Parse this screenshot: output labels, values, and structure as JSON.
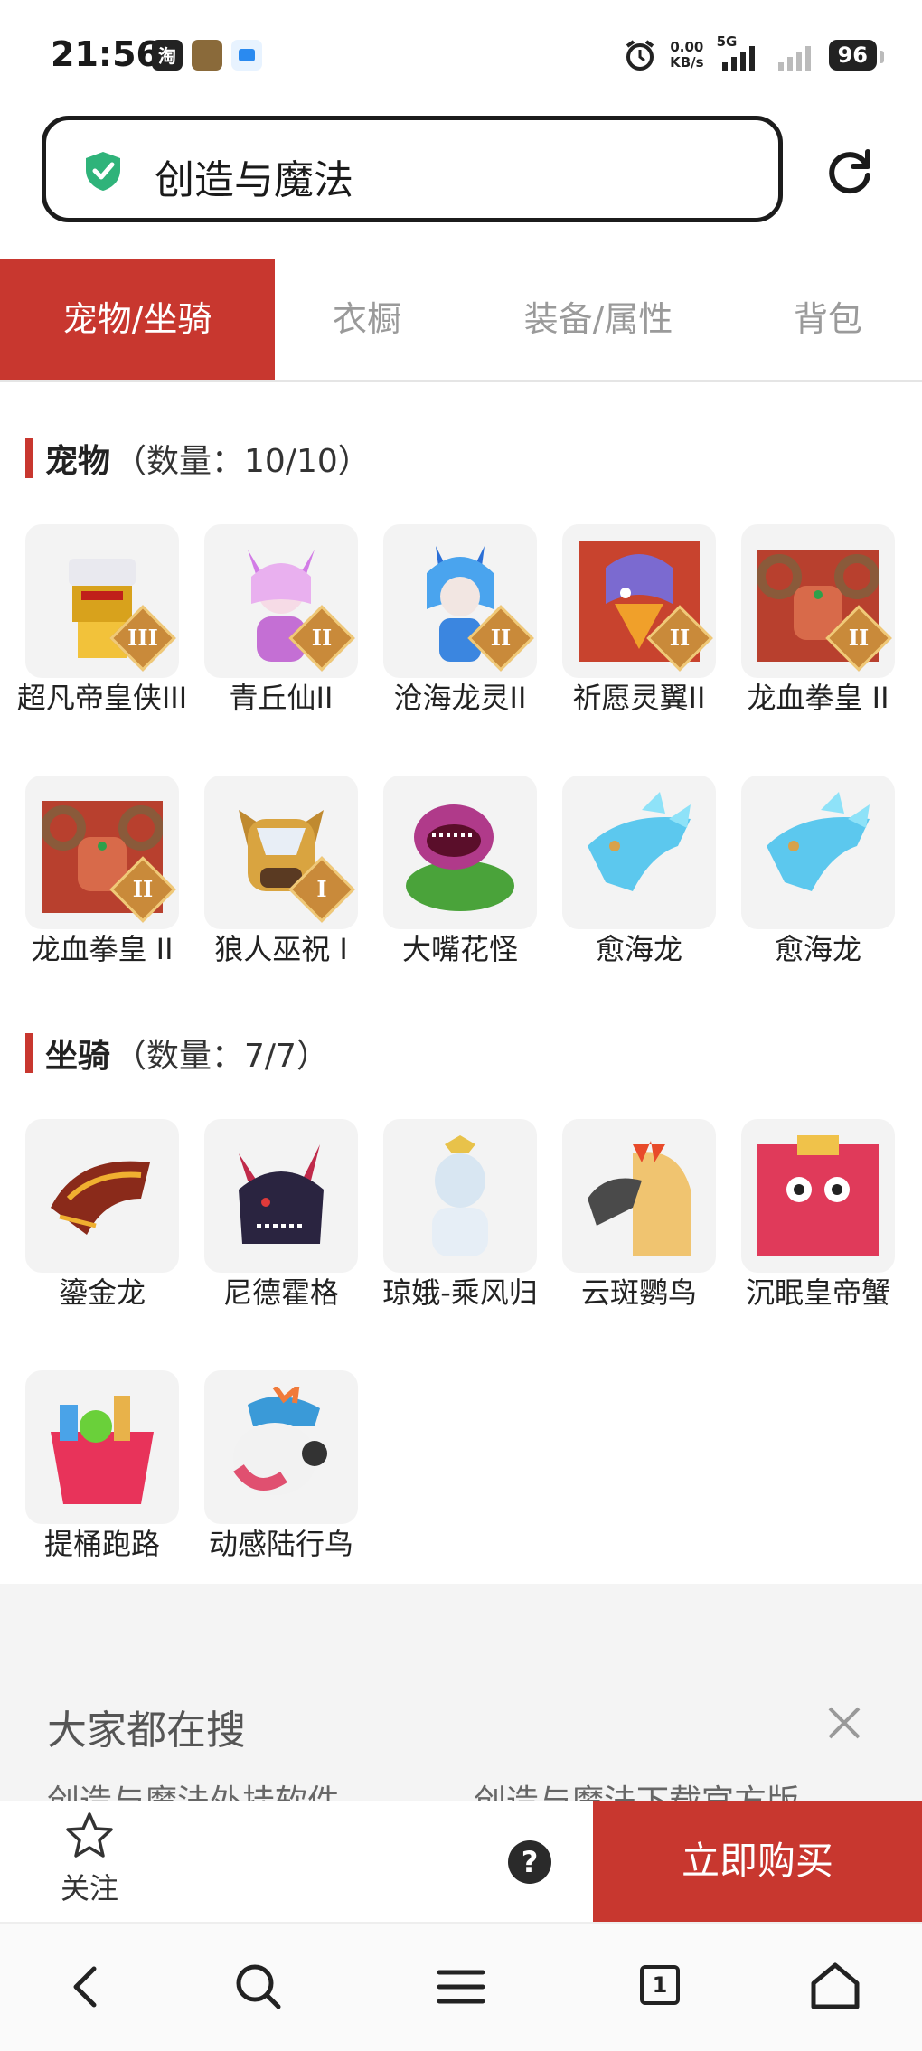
{
  "status_bar": {
    "time": "21:56",
    "network_speed_value": "0.00",
    "network_speed_unit": "KB/s",
    "network_type": "5G",
    "battery": "96",
    "app_icons": [
      "taobao-icon",
      "game-avatar-icon",
      "cloud-app-icon"
    ],
    "status_icons": [
      "alarm-icon",
      "signal-icon",
      "signal-weak-icon",
      "battery-icon"
    ]
  },
  "url_bar": {
    "title": "创造与魔法",
    "secure_icon": "shield-check-icon",
    "refresh_icon": "refresh-icon"
  },
  "tabs": [
    {
      "label": "宠物/坐骑",
      "active": true
    },
    {
      "label": "衣橱",
      "active": false
    },
    {
      "label": "装备/属性",
      "active": false
    },
    {
      "label": "背包",
      "active": false
    }
  ],
  "pets": {
    "title": "宠物",
    "count": "（数量：10/10）",
    "items": [
      {
        "label": "超凡帝皇侠III",
        "tier": "III"
      },
      {
        "label": "青丘仙II",
        "tier": "II"
      },
      {
        "label": "沧海龙灵II",
        "tier": "II"
      },
      {
        "label": "祈愿灵翼II",
        "tier": "II"
      },
      {
        "label": "龙血拳皇 II",
        "tier": "II"
      },
      {
        "label": "龙血拳皇 II",
        "tier": "II"
      },
      {
        "label": "狼人巫祝 I",
        "tier": "I"
      },
      {
        "label": "大嘴花怪",
        "tier": ""
      },
      {
        "label": "愈海龙",
        "tier": ""
      },
      {
        "label": "愈海龙",
        "tier": ""
      }
    ]
  },
  "mounts": {
    "title": "坐骑",
    "count": "（数量：7/7）",
    "items": [
      {
        "label": "鎏金龙"
      },
      {
        "label": "尼德霍格"
      },
      {
        "label": "琼娥-乘风归"
      },
      {
        "label": "云斑鹦鸟"
      },
      {
        "label": "沉眠皇帝蟹"
      },
      {
        "label": "提桶跑路"
      },
      {
        "label": "动感陆行鸟"
      }
    ]
  },
  "hot_search": {
    "title": "大家都在搜",
    "suggestions": [
      "创造与魔法外挂软件",
      "创造与魔法下载官方版"
    ],
    "close_icon": "close-icon"
  },
  "action_bar": {
    "follow_label": "关注",
    "help_glyph": "?",
    "buy_label": "立即购买"
  },
  "nav_bar": {
    "tab_count": "1",
    "icons": [
      "back-icon",
      "search-icon",
      "menu-icon",
      "tabs-icon",
      "home-icon"
    ]
  },
  "colors": {
    "accent": "#c8372f",
    "secure": "#2fb37a"
  }
}
